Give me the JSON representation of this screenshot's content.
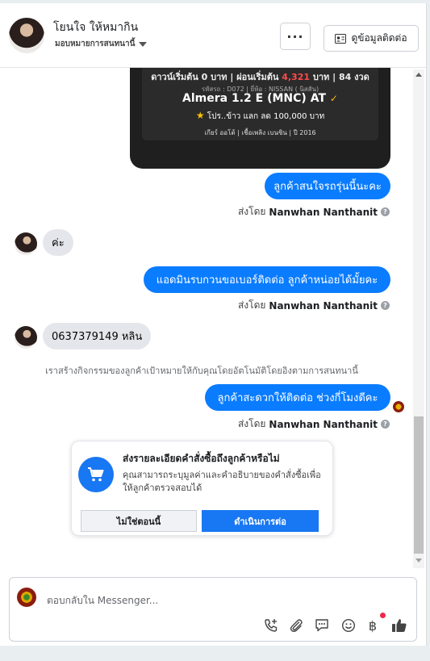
{
  "header": {
    "name": "โยนใจ ให้หมากิน",
    "subtitle": "มอบหมายการสนทนานี้",
    "more_label": "···",
    "contact_label": "ดูข้อมูลติดต่อ"
  },
  "car_card": {
    "price_line_prefix": "ดาวน์เริ่มต้น 0 บาท | ผ่อนเริ่มต้น",
    "price_highlight": "4,321",
    "price_line_suffix": "บาท | 84 งวด",
    "meta": "รหัสรถ : D072 | ยี่ห้อ : NISSAN ( นิสสัน)",
    "model": "Almera 1.2 E (MNC) AT",
    "model_mark": "✓",
    "promo": "โปร..ข้าว แลก ลด 100,000 บาท",
    "specs": "เกียร์ ออโต้ | เชื้อเพลิง เบนซิน | ปี 2016"
  },
  "messages": {
    "m1": "ลูกค้าสนใจรถรุ่นนี้นะคะ",
    "m2": "ค่ะ",
    "m3": "แอดมินรบกวนขอเบอร์ติดต่อ ลูกค้าหน่อยได้มั้ยคะ",
    "m4": "0637379149 หลิน",
    "m5": "ลูกค้าสะดวกให้ติดต่อ ช่วงกี่โมงดีคะ",
    "sent_by_prefix": "ส่งโดย",
    "sent_by_name": "Nanwhan Nanthanit",
    "system_note": "เราสร้างกิจกรรมของลูกค้าเป้าหมายให้กับคุณโดยอัตโนมัติโดยอิงตามการสนทนานี้"
  },
  "order_card": {
    "title": "ส่งรายละเอียดคำสั่งซื้อถึงลูกค้าหรือไม่",
    "description": "คุณสามารถระบุมูลค่าและคำอธิบายของคำสั่งซื้อเพื่อให้ลูกค้าตรวจสอบได้",
    "no_label": "ไม่ใช่ตอนนี้",
    "yes_label": "ดำเนินการต่อ"
  },
  "composer": {
    "placeholder": "ตอบกลับใน Messenger...",
    "currency_symbol": "฿"
  },
  "icons": {
    "more": "more-icon",
    "contact": "contact-card-icon",
    "cart": "shopping-cart-icon",
    "call": "phone-add-icon",
    "attach": "paperclip-icon",
    "saved_reply": "chat-bubble-icon",
    "emoji": "smile-icon",
    "payment": "baht-icon",
    "like": "thumbs-up-icon"
  },
  "colors": {
    "accent": "#1877f2",
    "bubble_out": "#0a7cff",
    "bubble_in": "#e4e6eb"
  }
}
